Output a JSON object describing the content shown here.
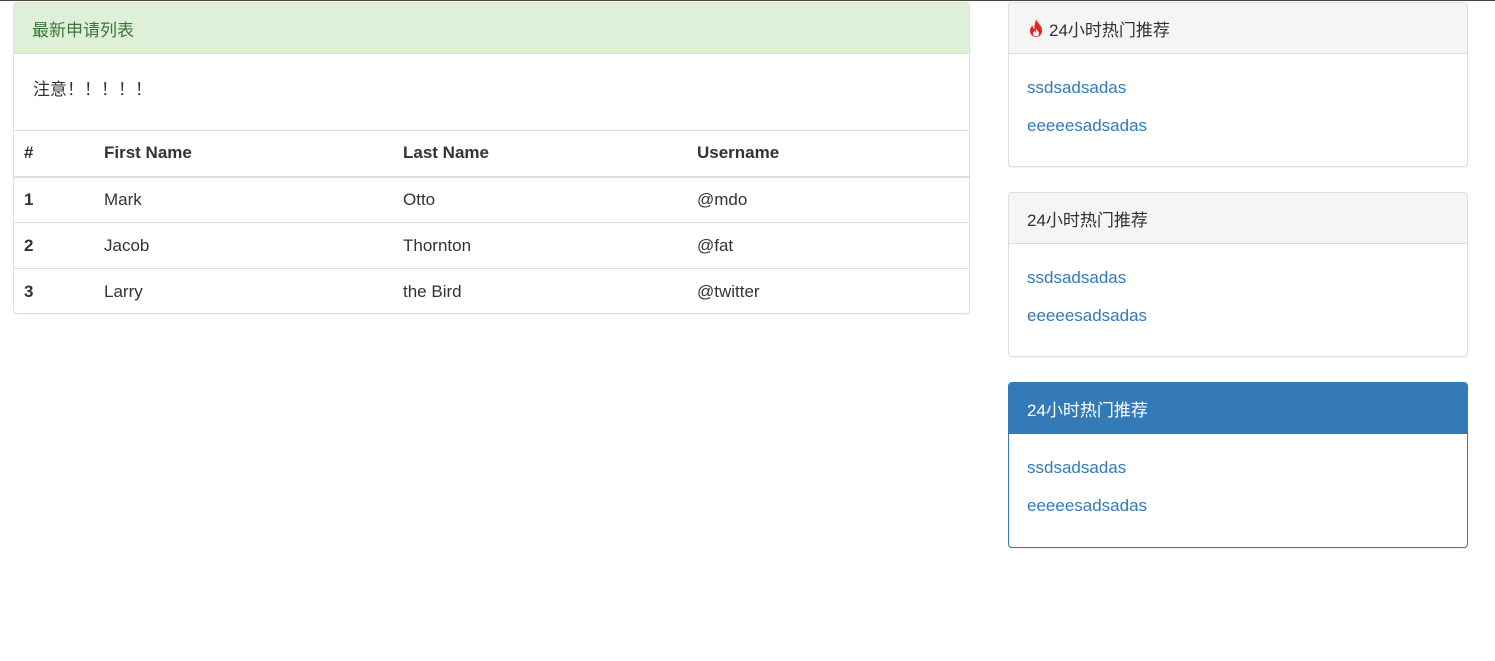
{
  "main_panel": {
    "title": "最新申请列表",
    "note": "注意！！！！！",
    "table": {
      "headers": [
        "#",
        "First Name",
        "Last Name",
        "Username"
      ],
      "rows": [
        [
          "1",
          "Mark",
          "Otto",
          "@mdo"
        ],
        [
          "2",
          "Jacob",
          "Thornton",
          "@fat"
        ],
        [
          "3",
          "Larry",
          "the Bird",
          "@twitter"
        ]
      ]
    }
  },
  "side_panels": [
    {
      "title": "24小时热门推荐",
      "icon": "fire-icon",
      "links": [
        "ssdsadsadas",
        "eeeeesadsadas"
      ]
    },
    {
      "title": "24小时热门推荐",
      "links": [
        "ssdsadsadas",
        "eeeeesadsadas"
      ]
    },
    {
      "title": "24小时热门推荐",
      "links": [
        "ssdsadsadas",
        "eeeeesadsadas"
      ]
    }
  ],
  "colors": {
    "success_bg": "#dff0d8",
    "success_text": "#3c763d",
    "primary": "#337ab7",
    "link": "#337ab7",
    "fire": "#e8231a"
  }
}
